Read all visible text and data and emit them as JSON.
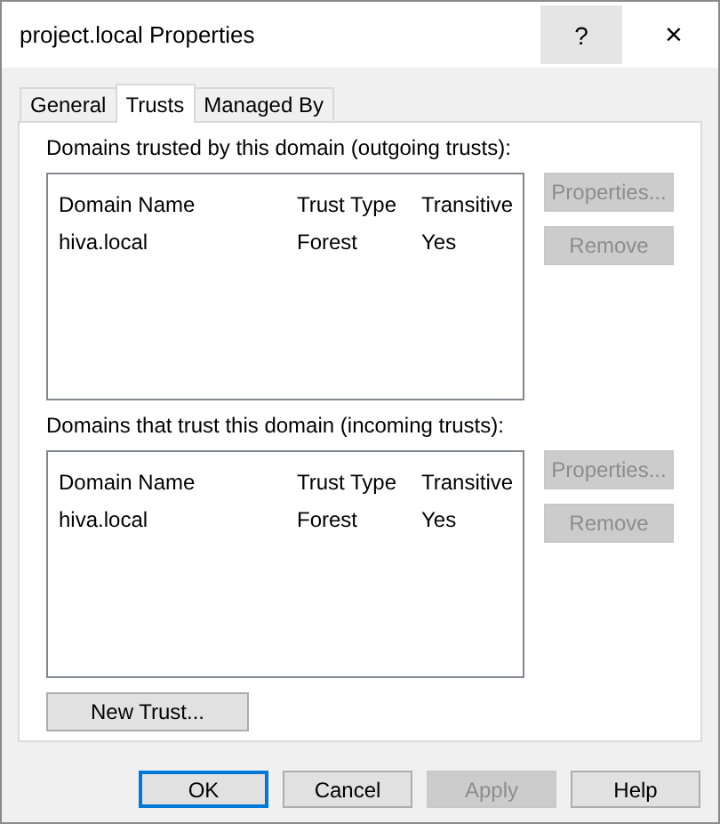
{
  "window": {
    "title": "project.local Properties",
    "help": "?",
    "close": "×"
  },
  "tabs": [
    {
      "label": "General",
      "selected": false
    },
    {
      "label": "Trusts",
      "selected": true
    },
    {
      "label": "Managed By",
      "selected": false
    }
  ],
  "sections": [
    {
      "label": "Domains trusted by this domain (outgoing trusts):",
      "columns": [
        "Domain Name",
        "Trust Type",
        "Transitive"
      ],
      "rows": [
        [
          "hiva.local",
          "Forest",
          "Yes"
        ]
      ],
      "buttons": [
        {
          "label": "Properties...",
          "disabled": true
        },
        {
          "label": "Remove",
          "disabled": true
        }
      ]
    },
    {
      "label": "Domains that trust this domain (incoming trusts):",
      "columns": [
        "Domain Name",
        "Trust Type",
        "Transitive"
      ],
      "rows": [
        [
          "hiva.local",
          "Forest",
          "Yes"
        ]
      ],
      "buttons": [
        {
          "label": "Properties...",
          "disabled": true
        },
        {
          "label": "Remove",
          "disabled": true
        }
      ]
    }
  ],
  "new_trust": {
    "label": "New Trust...",
    "disabled": false
  },
  "dialog_buttons": [
    {
      "label": "OK",
      "disabled": false,
      "default": true
    },
    {
      "label": "Cancel",
      "disabled": false,
      "default": false
    },
    {
      "label": "Apply",
      "disabled": true,
      "default": false
    },
    {
      "label": "Help",
      "disabled": false,
      "default": false
    }
  ]
}
